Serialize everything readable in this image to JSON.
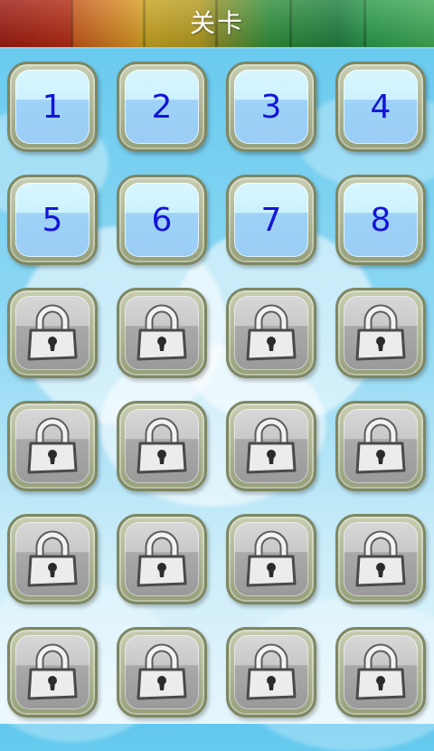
{
  "header": {
    "title": "关卡"
  },
  "levels": [
    {
      "label": "1",
      "locked": false
    },
    {
      "label": "2",
      "locked": false
    },
    {
      "label": "3",
      "locked": false
    },
    {
      "label": "4",
      "locked": false
    },
    {
      "label": "5",
      "locked": false
    },
    {
      "label": "6",
      "locked": false
    },
    {
      "label": "7",
      "locked": false
    },
    {
      "label": "8",
      "locked": false
    },
    {
      "label": "",
      "locked": true
    },
    {
      "label": "",
      "locked": true
    },
    {
      "label": "",
      "locked": true
    },
    {
      "label": "",
      "locked": true
    },
    {
      "label": "",
      "locked": true
    },
    {
      "label": "",
      "locked": true
    },
    {
      "label": "",
      "locked": true
    },
    {
      "label": "",
      "locked": true
    },
    {
      "label": "",
      "locked": true
    },
    {
      "label": "",
      "locked": true
    },
    {
      "label": "",
      "locked": true
    },
    {
      "label": "",
      "locked": true
    },
    {
      "label": "",
      "locked": true
    },
    {
      "label": "",
      "locked": true
    },
    {
      "label": "",
      "locked": true
    },
    {
      "label": "",
      "locked": true
    }
  ],
  "colors": {
    "number": "#1414d8",
    "tile_frame": "#96a07a",
    "open_face": "#9bcdf5",
    "locked_face": "#a9a9a9",
    "sky": "#63c8ee"
  },
  "icons": {
    "locked": "padlock-icon"
  }
}
